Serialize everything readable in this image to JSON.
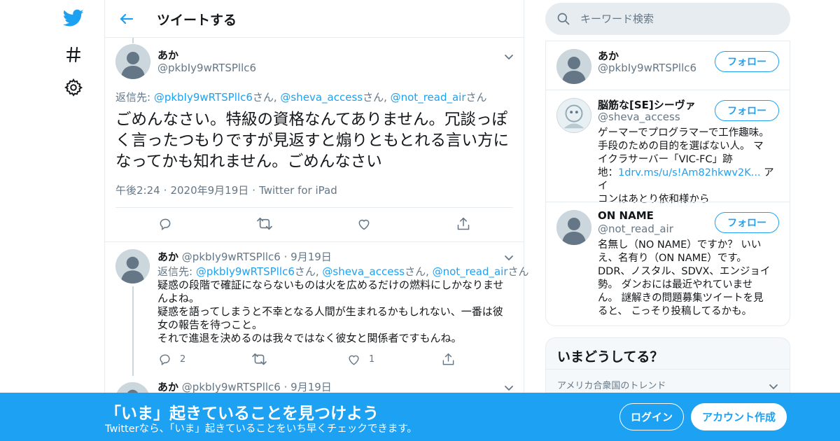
{
  "colors": {
    "accent": "#1da1f2",
    "text": "#14171a",
    "muted": "#657786",
    "border": "#e6ecf0"
  },
  "nav": {
    "icons": [
      "twitter-logo-icon",
      "hashtag-icon",
      "gear-icon"
    ]
  },
  "header": {
    "title": "ツイートする"
  },
  "focus_tweet": {
    "name": "あか",
    "handle": "@pkbIy9wRTSPllc6",
    "reply_prefix": "返信先: ",
    "reply_to": [
      "@pkbIy9wRTSPllc6",
      "@sheva_access",
      "@not_read_air"
    ],
    "reply_suffix": "さん",
    "reply_sep": "さん, ",
    "text": "ごめんなさい。特級の資格なんてありません。冗談っぽく言ったつもりですが見返すと煽りともとれる言い方になってかも知れません。ごめんなさい",
    "time": "午後2:24",
    "date": "2020年9月19日",
    "source": "Twitter for iPad",
    "dot": "·"
  },
  "replies": [
    {
      "name": "あか",
      "handle": "@pkbIy9wRTSPllc6",
      "date": "9月19日",
      "dot": "·",
      "reply_prefix": "返信先: ",
      "reply_to": [
        "@pkbIy9wRTSPllc6",
        "@sheva_access",
        "@not_read_air"
      ],
      "reply_sep": "さん, ",
      "reply_suffix": "さん",
      "lines": [
        "疑惑の段階で確証にならないものは火を広めるだけの燃料にしかなりませんよね。",
        "疑惑を語ってしまうと不幸となる人間が生まれるかもしれない、一番は彼女の報告を待つこと。",
        "それで進退を決めるのは我々ではなく彼女と関係者ですもんね。"
      ],
      "reply_count": "2",
      "like_count": "1"
    },
    {
      "name": "あか",
      "handle": "@pkbIy9wRTSPllc6",
      "date": "9月19日",
      "dot": "·"
    }
  ],
  "search": {
    "placeholder": "キーワード検索"
  },
  "who_to_follow": [
    {
      "name": "あか",
      "handle": "@pkbIy9wRTSPllc6",
      "button": "フォロー",
      "bio_lines": []
    },
    {
      "name": "脳筋な[SE]シーヴァ",
      "handle": "@sheva_access",
      "button": "フォロー",
      "bio_lines": [
        "ゲーマーでプログラマーで工作趣味。",
        "手段のための目的を選ばない人。 マ",
        "イクラサーバー「VIC-FC」跡"
      ],
      "bio_link_prefix": "地：",
      "bio_link": "1drv.ms/u/s!Am82hkwv2K...",
      "bio_after_link": " アイ",
      "bio_last": "コンはあとり依和様から"
    },
    {
      "name": "ON NAME",
      "handle": "@not_read_air",
      "button": "フォロー",
      "bio_lines": [
        "名無し（NO NAME）ですか？ いい",
        "え、名有り（ON NAME）です。",
        "DDR、ノスタル、SDVX、エンジョイ",
        "勢。 ダンおには最近やれていませ",
        "ん。 謎解きの問題募集ツイートを見",
        "ると、 こっそり投稿してるかも。"
      ]
    }
  ],
  "trends": {
    "title": "いまどうしてる？",
    "location": "アメリカ合衆国のトレンド"
  },
  "banner": {
    "title": "「いま」起きていることを見つけよう",
    "subtitle": "Twitterなら、「いま」起きていることをいち早くチェックできます。",
    "login": "ログイン",
    "signup": "アカウント作成"
  }
}
